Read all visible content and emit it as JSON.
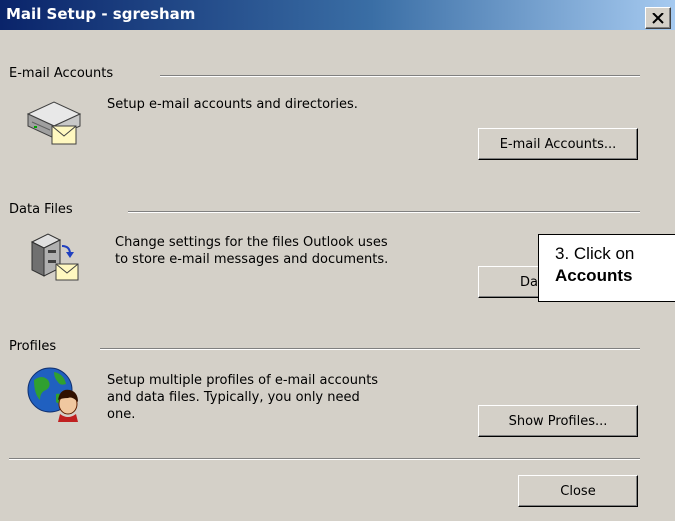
{
  "window": {
    "title": "Mail Setup - sgresham",
    "close_glyph": "✕"
  },
  "sections": {
    "email_accounts": {
      "label": "E-mail Accounts",
      "icon": "mail-server-icon",
      "description_lines": [
        "Setup e-mail accounts and directories."
      ],
      "button_label": "E-mail Accounts..."
    },
    "data_files": {
      "label": "Data Files",
      "icon": "data-files-icon",
      "description_lines": [
        "Change settings for the files Outlook uses",
        "to store e-mail messages and documents."
      ],
      "button_label": "Data Files..."
    },
    "profiles": {
      "label": "Profiles",
      "icon": "profiles-globe-icon",
      "description_lines": [
        "Setup multiple profiles of e-mail accounts",
        "and data files. Typically, you only need",
        "one."
      ],
      "button_label": "Show Profiles..."
    }
  },
  "footer": {
    "close_label": "Close"
  },
  "callout": {
    "line1": "3.  Click on",
    "line2": "Accounts"
  },
  "colors": {
    "dialog_bg": "#d4d0c8",
    "titlebar_start": "#0a246a",
    "titlebar_end": "#a6caf0"
  }
}
